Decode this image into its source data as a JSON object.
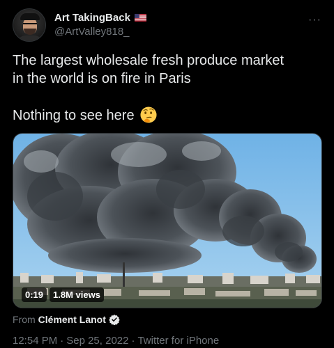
{
  "author": {
    "display_name": "Art TakingBack",
    "handle": "@ArtValley818_",
    "flag_icon": "us-flag-icon"
  },
  "more_label": "···",
  "tweet": {
    "line1": "The largest wholesale fresh produce market",
    "line2": "in the world is on fire in Paris",
    "line3": "Nothing to see here",
    "emoji_icon": "thinking-face-emoji"
  },
  "media": {
    "duration": "0:19",
    "views": "1.8M views"
  },
  "attribution": {
    "prefix": "From",
    "source": "Clément Lanot"
  },
  "meta": {
    "time": "12:54 PM",
    "date": "Sep 25, 2022",
    "client": "Twitter for iPhone",
    "separator": "·"
  },
  "colors": {
    "background": "#000000",
    "text_primary": "#e7e9ea",
    "text_secondary": "#71767b",
    "verified": "#1d9bf0"
  }
}
